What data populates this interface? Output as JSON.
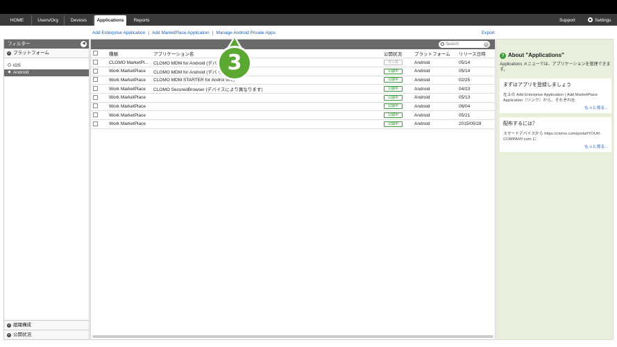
{
  "nav": {
    "tabs": [
      "HOME",
      "Users/Org",
      "Devices",
      "Applications",
      "Reports"
    ],
    "active": "Applications",
    "support": "Support",
    "settings": "Settings"
  },
  "links": {
    "add_enterprise": "Add Enterprise Application",
    "add_marketplace": "Add MarketPlace Application",
    "manage_private": "Manage Android Private Apps",
    "export": "Export"
  },
  "sidebar": {
    "header": "フィルター",
    "platform_section": "プラットフォーム",
    "items": [
      "iOS",
      "Android"
    ],
    "selected": "Android",
    "footer_org": "組織構成",
    "footer_status": "公開状況"
  },
  "search": {
    "placeholder": "Search"
  },
  "table": {
    "headers": [
      "種類",
      "アプリケーション名",
      "公開状況",
      "プラットフォーム",
      "リリース日時"
    ],
    "rows": [
      {
        "type": "CLOMO MarketPl...",
        "name": "CLOMO MDM for Android (デバ        ります)",
        "status": "非公開",
        "platform": "Android",
        "date": "05/14"
      },
      {
        "type": "Work MarketPlace",
        "name": "CLOMO MDM for Android (デバ        ります)",
        "status": "公開中",
        "platform": "Android",
        "date": "05/14"
      },
      {
        "type": "Work MarketPlace",
        "name": "CLOMO MDM STARTER for Androi        900)",
        "status": "公開中",
        "platform": "Android",
        "date": "02/25"
      },
      {
        "type": "Work MarketPlace",
        "name": "CLOMO SecuredBrowser (デバイスにより異なります)",
        "status": "公開中",
        "platform": "Android",
        "date": "04/23"
      },
      {
        "type": "Work MarketPlace",
        "name": "",
        "status": "公開中",
        "platform": "Android",
        "date": "05/13"
      },
      {
        "type": "Work MarketPlace",
        "name": "",
        "status": "公開中",
        "platform": "Android",
        "date": "06/04"
      },
      {
        "type": "Work MarketPlace",
        "name": "",
        "status": "公開中",
        "platform": "Android",
        "date": "05/21"
      },
      {
        "type": "Work MarketPlace",
        "name": "",
        "status": "公開中",
        "platform": "Android",
        "date": "2015/05/28"
      }
    ]
  },
  "help": {
    "title": "About \"Applications\"",
    "desc": "Applications メニューでは、アプリケーションを管理できます。",
    "card1_title": "まずはアプリを登録しましょう",
    "card1_text": "左上の Add Enterprise Application ( Add MarketPlace Application（リンク）から、それぞれ社",
    "card1_more": "もっと見る...",
    "card2_title": "配布するには？",
    "card2_text": "スマートデバイスから https://clomo.com/portal/YOUR-COMPANY.com に",
    "card2_more": "もっと見る..."
  },
  "annotation": {
    "step": "3"
  }
}
